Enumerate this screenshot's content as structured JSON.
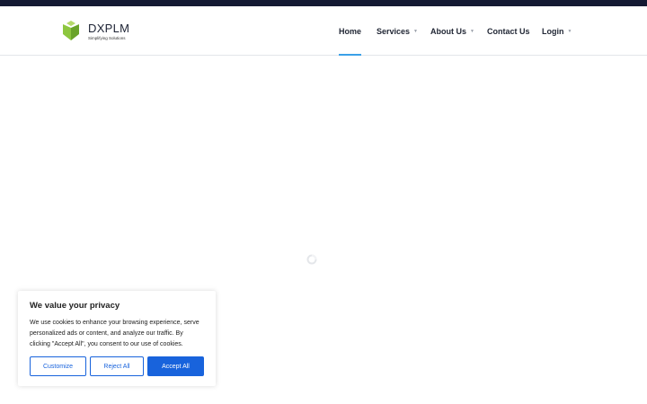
{
  "header": {
    "logo": {
      "name": "DXPLM",
      "tagline": "Simplifying Solutions",
      "colors": [
        "#8dc63f",
        "#6aa32a",
        "#b5d96a"
      ]
    },
    "nav": [
      {
        "label": "Home",
        "active": true,
        "dropdown": false
      },
      {
        "label": "Services",
        "active": false,
        "dropdown": true
      },
      {
        "label": "About Us",
        "active": false,
        "dropdown": true
      },
      {
        "label": "Contact Us",
        "active": false,
        "dropdown": false
      },
      {
        "label": "Login",
        "active": false,
        "dropdown": true
      }
    ],
    "accent": "#3aa0e8"
  },
  "loader": {
    "icon": "loading-spinner-icon"
  },
  "cookie_banner": {
    "title": "We value your privacy",
    "text": "We use cookies to enhance your browsing experience, serve personalized ads or content, and analyze our traffic. By clicking \"Accept All\", you consent to our use of cookies.",
    "buttons": {
      "customize": "Customize",
      "reject": "Reject All",
      "accept": "Accept All"
    },
    "accent": "#1863dc"
  }
}
